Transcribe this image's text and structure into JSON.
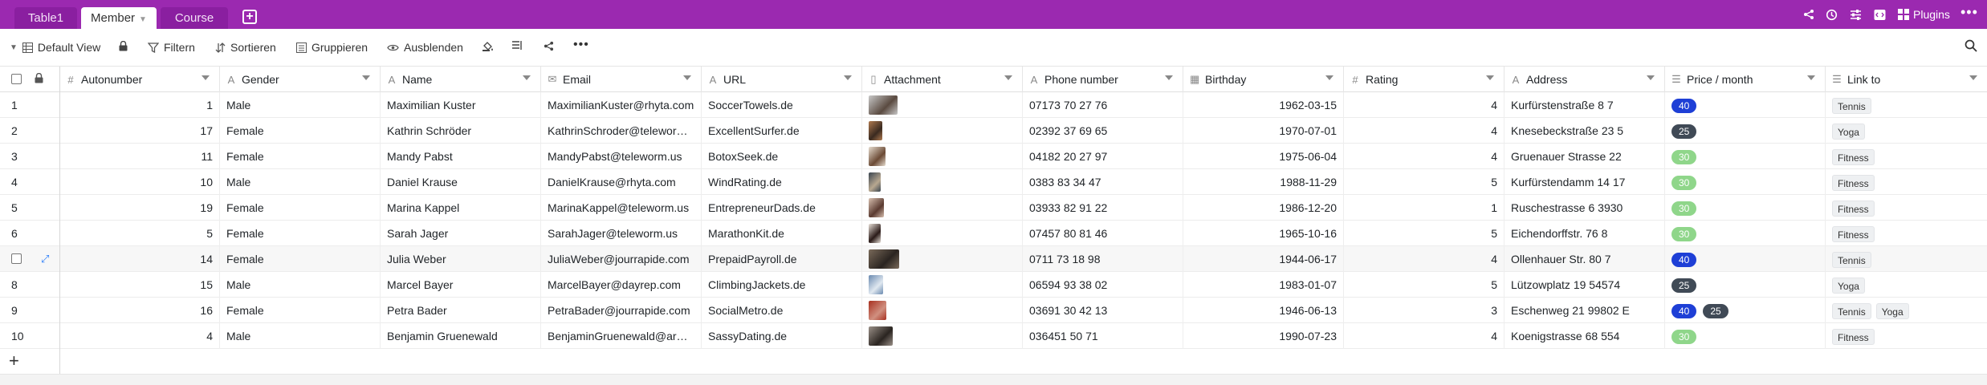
{
  "tabs": [
    {
      "label": "Table1",
      "active": false
    },
    {
      "label": "Member",
      "active": true
    },
    {
      "label": "Course",
      "active": false
    }
  ],
  "top_icons": {
    "plugins_label": "Plugins"
  },
  "toolbar": {
    "view_label": "Default View",
    "filter_label": "Filtern",
    "sort_label": "Sortieren",
    "group_label": "Gruppieren",
    "hide_label": "Ausblenden"
  },
  "columns": [
    {
      "name": "Autonumber",
      "icon": "#"
    },
    {
      "name": "Gender",
      "icon": "A"
    },
    {
      "name": "Name",
      "icon": "A"
    },
    {
      "name": "Email",
      "icon": "✉"
    },
    {
      "name": "URL",
      "icon": "A"
    },
    {
      "name": "Attachment",
      "icon": "📄"
    },
    {
      "name": "Phone number",
      "icon": "A"
    },
    {
      "name": "Birthday",
      "icon": "▦"
    },
    {
      "name": "Rating",
      "icon": "#"
    },
    {
      "name": "Address",
      "icon": "A"
    },
    {
      "name": "Price / month",
      "icon": "☰"
    },
    {
      "name": "Link to",
      "icon": "☰"
    }
  ],
  "colors": {
    "topbar": "#9b29b0",
    "pill_40": "#1e3fd6",
    "pill_25": "#404a56",
    "pill_30": "#8fd68a",
    "accent_blue": "#2d7ff9"
  },
  "rows": [
    {
      "idx": "1",
      "auto": "1",
      "gender": "Male",
      "name": "Maximilian Kuster",
      "email": "MaximilianKuster@rhyta.com",
      "url": "SoccerTowels.de",
      "phone": "07173 70 27 76",
      "birthday": "1962-03-15",
      "rating": "4",
      "address": "Kurfürstenstraße 8 7",
      "prices": [
        "40"
      ],
      "links": [
        "Tennis"
      ]
    },
    {
      "idx": "2",
      "auto": "17",
      "gender": "Female",
      "name": "Kathrin Schröder",
      "email": "KathrinSchroder@telewor…",
      "url": "ExcellentSurfer.de",
      "phone": "02392 37 69 65",
      "birthday": "1970-07-01",
      "rating": "4",
      "address": "Knesebeckstraße 23 5",
      "prices": [
        "25"
      ],
      "links": [
        "Yoga"
      ]
    },
    {
      "idx": "3",
      "auto": "11",
      "gender": "Female",
      "name": "Mandy Pabst",
      "email": "MandyPabst@teleworm.us",
      "url": "BotoxSeek.de",
      "phone": "04182 20 27 97",
      "birthday": "1975-06-04",
      "rating": "4",
      "address": "Gruenauer Strasse 22",
      "prices": [
        "30"
      ],
      "links": [
        "Fitness"
      ]
    },
    {
      "idx": "4",
      "auto": "10",
      "gender": "Male",
      "name": "Daniel Krause",
      "email": "DanielKrause@rhyta.com",
      "url": "WindRating.de",
      "phone": "0383 83 34 47",
      "birthday": "1988-11-29",
      "rating": "5",
      "address": "Kurfürstendamm 14 17",
      "prices": [
        "30"
      ],
      "links": [
        "Fitness"
      ]
    },
    {
      "idx": "5",
      "auto": "19",
      "gender": "Female",
      "name": "Marina Kappel",
      "email": "MarinaKappel@teleworm.us",
      "url": "EntrepreneurDads.de",
      "phone": "03933 82 91 22",
      "birthday": "1986-12-20",
      "rating": "1",
      "address": "Ruschestrasse 6 3930",
      "prices": [
        "30"
      ],
      "links": [
        "Fitness"
      ]
    },
    {
      "idx": "6",
      "auto": "5",
      "gender": "Female",
      "name": "Sarah Jager",
      "email": "SarahJager@teleworm.us",
      "url": "MarathonKit.de",
      "phone": "07457 80 81 46",
      "birthday": "1965-10-16",
      "rating": "5",
      "address": "Eichendorffstr. 76 8",
      "prices": [
        "30"
      ],
      "links": [
        "Fitness"
      ]
    },
    {
      "idx": "7",
      "auto": "14",
      "gender": "Female",
      "name": "Julia Weber",
      "email": "JuliaWeber@jourrapide.com",
      "url": "PrepaidPayroll.de",
      "phone": "0711 73 18 98",
      "birthday": "1944-06-17",
      "rating": "4",
      "address": "Ollenhauer Str. 80 7",
      "prices": [
        "40"
      ],
      "links": [
        "Tennis"
      ]
    },
    {
      "idx": "8",
      "auto": "15",
      "gender": "Male",
      "name": "Marcel Bayer",
      "email": "MarcelBayer@dayrep.com",
      "url": "ClimbingJackets.de",
      "phone": "06594 93 38 02",
      "birthday": "1983-01-07",
      "rating": "5",
      "address": "Lützowplatz 19 54574",
      "prices": [
        "25"
      ],
      "links": [
        "Yoga"
      ]
    },
    {
      "idx": "9",
      "auto": "16",
      "gender": "Female",
      "name": "Petra Bader",
      "email": "PetraBader@jourrapide.com",
      "url": "SocialMetro.de",
      "phone": "03691 30 42 13",
      "birthday": "1946-06-13",
      "rating": "3",
      "address": "Eschenweg 21 99802 E",
      "prices": [
        "40",
        "25"
      ],
      "links": [
        "Tennis",
        "Yoga"
      ]
    },
    {
      "idx": "10",
      "auto": "4",
      "gender": "Male",
      "name": "Benjamin Gruenewald",
      "email": "BenjaminGruenewald@ar…",
      "url": "SassyDating.de",
      "phone": "036451 50 71",
      "birthday": "1990-07-23",
      "rating": "4",
      "address": "Koenigstrasse 68 554",
      "prices": [
        "30"
      ],
      "links": [
        "Fitness"
      ]
    }
  ]
}
